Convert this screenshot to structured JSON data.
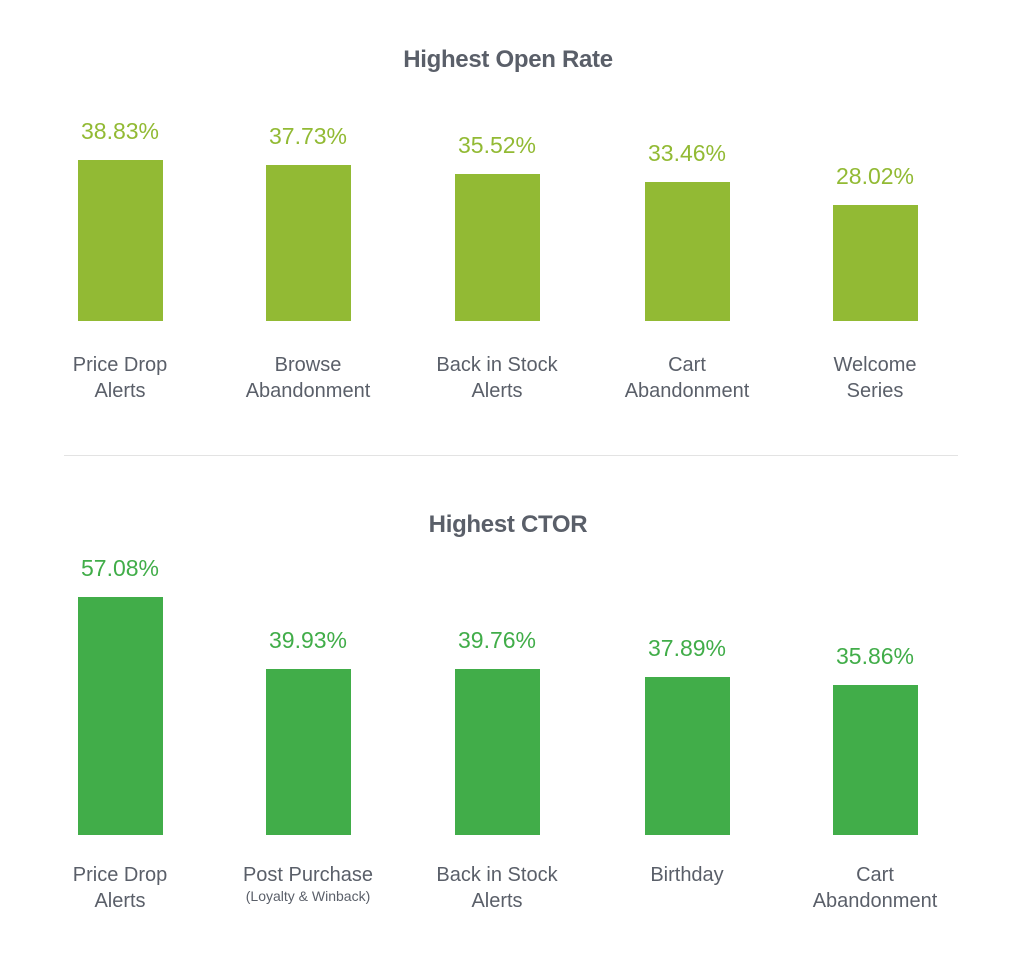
{
  "chart_data": [
    {
      "type": "bar",
      "title": "Highest Open Rate",
      "categories": [
        {
          "line1": "Price Drop",
          "line2": "Alerts"
        },
        {
          "line1": "Browse",
          "line2": "Abandonment"
        },
        {
          "line1": "Back in Stock",
          "line2": "Alerts"
        },
        {
          "line1": "Cart",
          "line2": "Abandonment"
        },
        {
          "line1": "Welcome",
          "line2": "Series"
        }
      ],
      "values": [
        38.83,
        37.73,
        35.52,
        33.46,
        28.02
      ],
      "value_labels": [
        "38.83%",
        "37.73%",
        "35.52%",
        "33.46%",
        "28.02%"
      ],
      "unit": "%",
      "color": "#92ba34",
      "xlabel": "",
      "ylabel": "",
      "grid": false
    },
    {
      "type": "bar",
      "title": "Highest CTOR",
      "categories": [
        {
          "line1": "Price Drop",
          "line2": "Alerts"
        },
        {
          "line1": "Post Purchase",
          "sub": "(Loyalty & Winback)"
        },
        {
          "line1": "Back in Stock",
          "line2": "Alerts"
        },
        {
          "line1": "Birthday"
        },
        {
          "line1": "Cart",
          "line2": "Abandonment"
        }
      ],
      "values": [
        57.08,
        39.93,
        39.76,
        37.89,
        35.86
      ],
      "value_labels": [
        "57.08%",
        "39.93%",
        "39.76%",
        "37.89%",
        "35.86%"
      ],
      "unit": "%",
      "color": "#41ad49",
      "xlabel": "",
      "ylabel": "",
      "grid": false
    }
  ]
}
